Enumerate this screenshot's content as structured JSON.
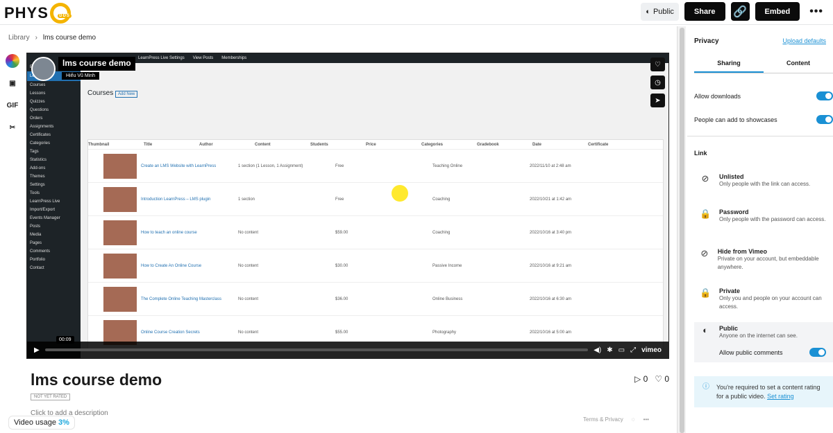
{
  "app": {
    "logo_text": "PHYS",
    "logo_badge": "DDS"
  },
  "topbar": {
    "public_label": "Public",
    "share_label": "Share",
    "embed_label": "Embed",
    "more_label": "•••"
  },
  "breadcrumb": {
    "root": "Library",
    "current": "lms course demo"
  },
  "sidebar_tools": {
    "gif": "GIF"
  },
  "video": {
    "title": "lms course demo",
    "author": "Hiếu Vũ Minh",
    "timestamp": "00:09",
    "brand": "vimeo"
  },
  "embedded_page": {
    "wp_bar": [
      "LearnPress Live Settings",
      "View Posts",
      "Memberships"
    ],
    "sidebar": [
      "Eduma",
      "LearnPress",
      "Courses",
      "Lessons",
      "Quizzes",
      "Questions",
      "Orders",
      "Assignments",
      "Certificates",
      "Categories",
      "Tags",
      "Statistics",
      "Add-ons",
      "Themes",
      "Settings",
      "Tools",
      "LearnPress Live",
      "Import/Export",
      "Events Manager",
      "Posts",
      "Media",
      "Pages",
      "Comments",
      "Portfolio",
      "Contact"
    ],
    "heading": "Courses",
    "add_new": "Add New",
    "table_headers": [
      "Thumbnail",
      "Title",
      "Author",
      "Content",
      "Students",
      "Price",
      "Categories",
      "Gradebook",
      "Date",
      "Certificate"
    ],
    "rows": [
      {
        "title": "Create an LMS Website with LearnPress",
        "content": "1 section (1 Lesson, 1 Assignment)",
        "price": "Free",
        "category": "Teaching Online",
        "date": "2022/11/10 at 2:48 am"
      },
      {
        "title": "Introduction LearnPress – LMS plugin",
        "content": "1 section",
        "price": "Free",
        "category": "Coaching",
        "date": "2022/10/21 at 1:42 am"
      },
      {
        "title": "How to teach an online course",
        "content": "No content",
        "price": "$59.00",
        "category": "Coaching",
        "date": "2022/10/16 at 3:40 pm"
      },
      {
        "title": "How to Create An Online Course",
        "content": "No content",
        "price": "$30.00",
        "category": "Passive Income",
        "date": "2022/10/16 at 9:21 am"
      },
      {
        "title": "The Complete Online Teaching Masterclass",
        "content": "No content",
        "price": "$36.00",
        "category": "Online Business",
        "date": "2022/10/16 at 6:30 am"
      },
      {
        "title": "Online Course Creation Secrets",
        "content": "No content",
        "price": "$55.00",
        "category": "Photography",
        "date": "2022/10/16 at 5:00 am"
      }
    ]
  },
  "page": {
    "title": "lms course demo",
    "plays": "0",
    "likes": "0",
    "rating_badge": "NOT YET RATED",
    "description_placeholder": "Click to add a description",
    "usage_label": "Video usage",
    "usage_value": "3%",
    "terms": "Terms & Privacy"
  },
  "privacy": {
    "header": "Privacy",
    "upload_defaults": "Upload defaults",
    "tabs": [
      "Sharing",
      "Content"
    ],
    "allow_downloads": "Allow downloads",
    "showcases": "People can add to showcases",
    "link_label": "Link",
    "options": [
      {
        "title": "Unlisted",
        "desc": "Only people with the link can access.",
        "icon": "eye-slash-icon"
      },
      {
        "title": "Password",
        "desc": "Only people with the password can access.",
        "icon": "lock-dots-icon"
      },
      {
        "title": "Hide from Vimeo",
        "desc": "Private on your account, but embeddable anywhere.",
        "icon": "eye-slash-icon"
      },
      {
        "title": "Private",
        "desc": "Only you and people on your account can access.",
        "icon": "lock-icon"
      },
      {
        "title": "Public",
        "desc": "Anyone on the internet can see.",
        "icon": "globe-icon"
      }
    ],
    "allow_comments": "Allow public comments",
    "notice_text": "You're required to set a content rating for a public video.",
    "notice_link": "Set rating",
    "accent": "#1a90d4"
  }
}
